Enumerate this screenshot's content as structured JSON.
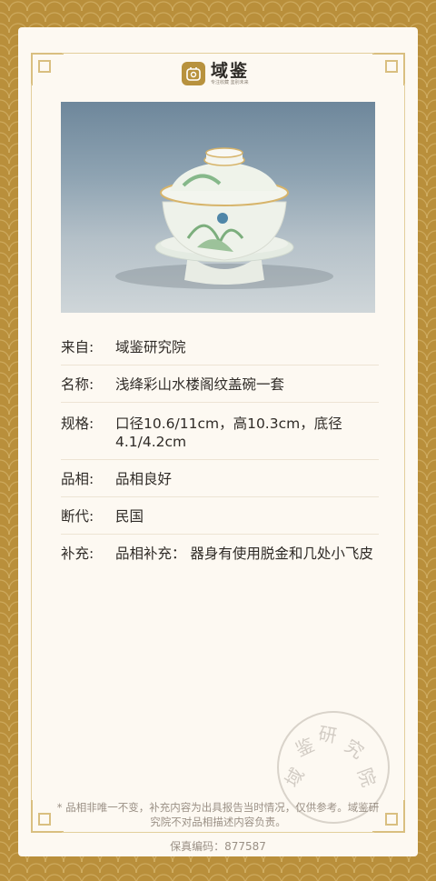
{
  "brand": {
    "name": "域鉴",
    "slogan": "专注收藏 鉴别未来",
    "primary_color": "#b8923e"
  },
  "details": [
    {
      "label": "来自:",
      "value": "域鉴研究院"
    },
    {
      "label": "名称:",
      "value": "浅绛彩山水楼阁纹盖碗一套"
    },
    {
      "label": "规格:",
      "value": " 口径10.6/11cm，高10.3cm，底径4.1/4.2cm"
    },
    {
      "label": "品相:",
      "value": " 品相良好"
    },
    {
      "label": "断代:",
      "value": "民国"
    },
    {
      "label": "补充:",
      "value": "品相补充： 器身有使用脱金和几处小飞皮"
    }
  ],
  "stamp": {
    "text": "域鉴研究院"
  },
  "disclaimer": "* 品相非唯一不变，补充内容为出具报告当时情况，仅供参考。域鉴研究院不对品相描述内容负责。",
  "serial_label": "保真编码：877587"
}
